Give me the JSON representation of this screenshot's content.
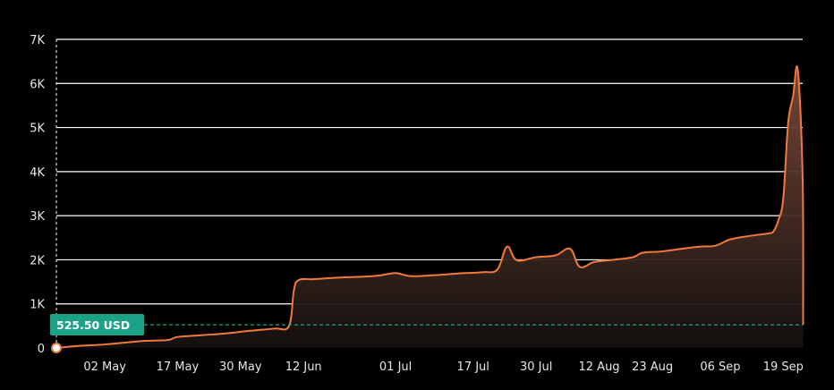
{
  "chart_data": {
    "type": "area",
    "x_ticks": [
      "02 May",
      "17 May",
      "30 May",
      "12 Jun",
      "01 Jul",
      "17 Jul",
      "30 Jul",
      "12 Aug",
      "23 Aug",
      "06 Sep",
      "19 Sep"
    ],
    "y_ticks": [
      "0",
      "1K",
      "2K",
      "3K",
      "4K",
      "5K",
      "6K",
      "7K"
    ],
    "ylim": [
      0,
      7000
    ],
    "grid": true,
    "reference_line": {
      "value": 525.5,
      "label": "525.50 USD"
    },
    "series": [
      {
        "points": [
          [
            "2018-04-22",
            0
          ],
          [
            "2018-04-26",
            40
          ],
          [
            "2018-05-02",
            80
          ],
          [
            "2018-05-06",
            120
          ],
          [
            "2018-05-10",
            160
          ],
          [
            "2018-05-15",
            180
          ],
          [
            "2018-05-17",
            250
          ],
          [
            "2018-05-22",
            290
          ],
          [
            "2018-05-27",
            330
          ],
          [
            "2018-06-01",
            390
          ],
          [
            "2018-06-06",
            440
          ],
          [
            "2018-06-09",
            500
          ],
          [
            "2018-06-10",
            1300
          ],
          [
            "2018-06-11",
            1540
          ],
          [
            "2018-06-14",
            1560
          ],
          [
            "2018-06-20",
            1600
          ],
          [
            "2018-06-25",
            1620
          ],
          [
            "2018-06-28",
            1650
          ],
          [
            "2018-07-01",
            1700
          ],
          [
            "2018-07-04",
            1630
          ],
          [
            "2018-07-09",
            1650
          ],
          [
            "2018-07-14",
            1690
          ],
          [
            "2018-07-19",
            1720
          ],
          [
            "2018-07-22",
            1780
          ],
          [
            "2018-07-24",
            2300
          ],
          [
            "2018-07-26",
            1990
          ],
          [
            "2018-07-30",
            2060
          ],
          [
            "2018-08-03",
            2100
          ],
          [
            "2018-08-06",
            2250
          ],
          [
            "2018-08-08",
            1840
          ],
          [
            "2018-08-11",
            1950
          ],
          [
            "2018-08-15",
            2000
          ],
          [
            "2018-08-19",
            2060
          ],
          [
            "2018-08-21",
            2160
          ],
          [
            "2018-08-25",
            2190
          ],
          [
            "2018-08-29",
            2250
          ],
          [
            "2018-09-02",
            2300
          ],
          [
            "2018-09-05",
            2320
          ],
          [
            "2018-09-08",
            2460
          ],
          [
            "2018-09-12",
            2540
          ],
          [
            "2018-09-16",
            2600
          ],
          [
            "2018-09-17",
            2650
          ],
          [
            "2018-09-18",
            2900
          ],
          [
            "2018-09-19",
            3400
          ],
          [
            "2018-09-20",
            5100
          ],
          [
            "2018-09-21",
            5700
          ],
          [
            "2018-09-22",
            6300
          ],
          [
            "2018-09-23",
            3800
          ],
          [
            "2018-09-23",
            525.5
          ]
        ]
      }
    ]
  }
}
